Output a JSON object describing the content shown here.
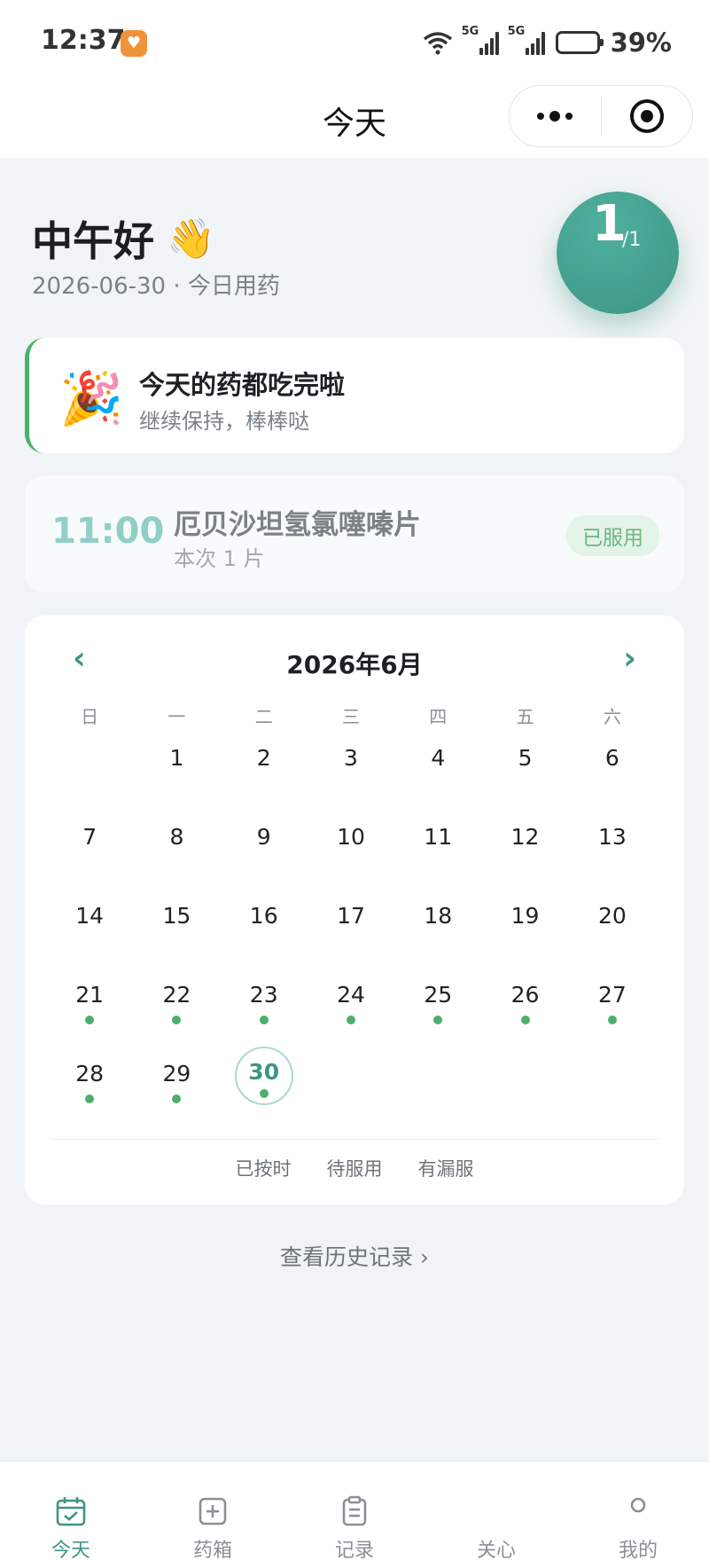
{
  "status_bar": {
    "time": "12:37",
    "sim1_label": "5G",
    "sim2_label": "5G",
    "battery_pct": "39%",
    "battery_level": 0.39
  },
  "nav": {
    "title": "今天"
  },
  "greeting": {
    "text": "中午好",
    "emoji": "👋",
    "date_line": "2026-06-30 · 今日用药",
    "progress_done": "1",
    "progress_total": "/1"
  },
  "done_card": {
    "emoji": "🎉",
    "title": "今天的药都吃完啦",
    "subtitle": "继续保持，棒棒哒"
  },
  "dose": {
    "time": "11:00",
    "name": "厄贝沙坦氢氯噻嗪片",
    "amount": "本次 1 片",
    "status": "已服用"
  },
  "calendar": {
    "prev": "‹",
    "next": "›",
    "title": "2026年6月",
    "weekdays": [
      "日",
      "一",
      "二",
      "三",
      "四",
      "五",
      "六"
    ],
    "leading_blanks": 1,
    "days": [
      {
        "n": "1"
      },
      {
        "n": "2"
      },
      {
        "n": "3"
      },
      {
        "n": "4"
      },
      {
        "n": "5"
      },
      {
        "n": "6"
      },
      {
        "n": "7"
      },
      {
        "n": "8"
      },
      {
        "n": "9"
      },
      {
        "n": "10"
      },
      {
        "n": "11"
      },
      {
        "n": "12"
      },
      {
        "n": "13"
      },
      {
        "n": "14"
      },
      {
        "n": "15"
      },
      {
        "n": "16"
      },
      {
        "n": "17"
      },
      {
        "n": "18"
      },
      {
        "n": "19"
      },
      {
        "n": "20"
      },
      {
        "n": "21",
        "dot": true
      },
      {
        "n": "22",
        "dot": true
      },
      {
        "n": "23",
        "dot": true
      },
      {
        "n": "24",
        "dot": true
      },
      {
        "n": "25",
        "dot": true
      },
      {
        "n": "26",
        "dot": true
      },
      {
        "n": "27",
        "dot": true
      },
      {
        "n": "28",
        "dot": true
      },
      {
        "n": "29",
        "dot": true
      },
      {
        "n": "30",
        "dot": true,
        "today": true
      }
    ],
    "legend": [
      "已按时",
      "待服用",
      "有漏服"
    ],
    "dot_color": "#4caf6a"
  },
  "history_link": "查看历史记录 ›",
  "tabs": [
    {
      "label": "今天",
      "icon": "calendar-check-icon",
      "active": true
    },
    {
      "label": "药箱",
      "icon": "medicine-box-icon",
      "active": false
    },
    {
      "label": "记录",
      "icon": "clipboard-icon",
      "active": false
    },
    {
      "label": "关心",
      "icon": "heart-icon",
      "active": false
    },
    {
      "label": "我的",
      "icon": "user-icon",
      "active": false
    }
  ],
  "colors": {
    "accent": "#3e9584",
    "success": "#4caf6a",
    "background": "#f1f4f6"
  }
}
